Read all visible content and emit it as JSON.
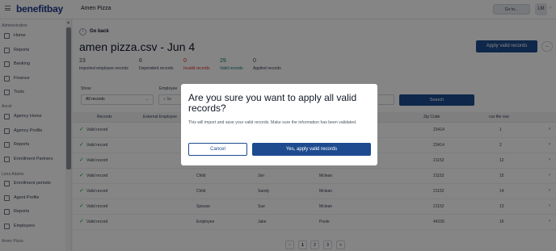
{
  "topbar": {
    "logo": "benefitbay",
    "org_name": "Amen Pizza",
    "goto_label": "Go to...",
    "avatar_initials": "LM"
  },
  "sidebar": {
    "sections": [
      {
        "title": "Administration",
        "items": [
          "Home",
          "Reports",
          "Banking",
          "Finance",
          "Tools"
        ]
      },
      {
        "title": "Ancel",
        "items": [
          "Agency Home",
          "Agency Profile",
          "Reports",
          "Enrollment Partners"
        ]
      },
      {
        "title": "Lena Adams",
        "items": [
          "Enrollment periods",
          "Agent Profile",
          "Reports",
          "Employers"
        ]
      },
      {
        "title": "Amen Pizza",
        "items": []
      }
    ]
  },
  "main": {
    "go_back": "Go back",
    "title": "amen pizza.csv - Jun 4",
    "apply_button": "Apply valid records",
    "more_label": "...",
    "stats": [
      {
        "value": "23",
        "label": "Imported employee records",
        "color": "#374151"
      },
      {
        "value": "6",
        "label": "Dependent records",
        "color": "#374151"
      },
      {
        "value": "0",
        "label": "Invalid records",
        "color": "#dc2626"
      },
      {
        "value": "29",
        "label": "Valid records",
        "color": "#0f766e"
      },
      {
        "value": "0",
        "label": "Applied records",
        "color": "#374151"
      }
    ],
    "filters": {
      "show_label": "Show",
      "show_value": "All records",
      "employee_label": "Employee",
      "employee_placeholder": "Se",
      "search_button": "Search"
    },
    "table": {
      "headers": [
        "Records",
        "External Employee",
        "Zip Code",
        "csv file row"
      ],
      "rows": [
        {
          "status": "Valid record",
          "relationship": "",
          "first": "",
          "last": "",
          "zip": "23414",
          "row": "1"
        },
        {
          "status": "Valid record",
          "relationship": "",
          "first": "",
          "last": "",
          "zip": "23414",
          "row": "2"
        },
        {
          "status": "Valid record",
          "relationship": "",
          "first": "",
          "last": "",
          "zip": "21152",
          "row": "12"
        },
        {
          "status": "Valid record",
          "relationship": "Child",
          "first": "Jon",
          "last": "Mclean",
          "zip": "21152",
          "row": "15"
        },
        {
          "status": "Valid record",
          "relationship": "Child",
          "first": "Sandy",
          "last": "Mclean",
          "zip": "21152",
          "row": "14"
        },
        {
          "status": "Valid record",
          "relationship": "Spouse",
          "first": "Sue",
          "last": "Mclean",
          "zip": "21152",
          "row": "13"
        },
        {
          "status": "Valid record",
          "relationship": "Employee",
          "first": "Jake",
          "last": "Poole",
          "zip": "44106",
          "row": "16"
        }
      ]
    },
    "pagination": {
      "prev": "<",
      "pages": [
        "1",
        "2",
        "3"
      ],
      "next": ">"
    }
  },
  "modal": {
    "title": "Are you sure you want to apply all valid records?",
    "text": "This will import and save your valid records. Make sure the information has been validated.",
    "cancel": "Cancel",
    "confirm": "Yes, apply valid records"
  }
}
